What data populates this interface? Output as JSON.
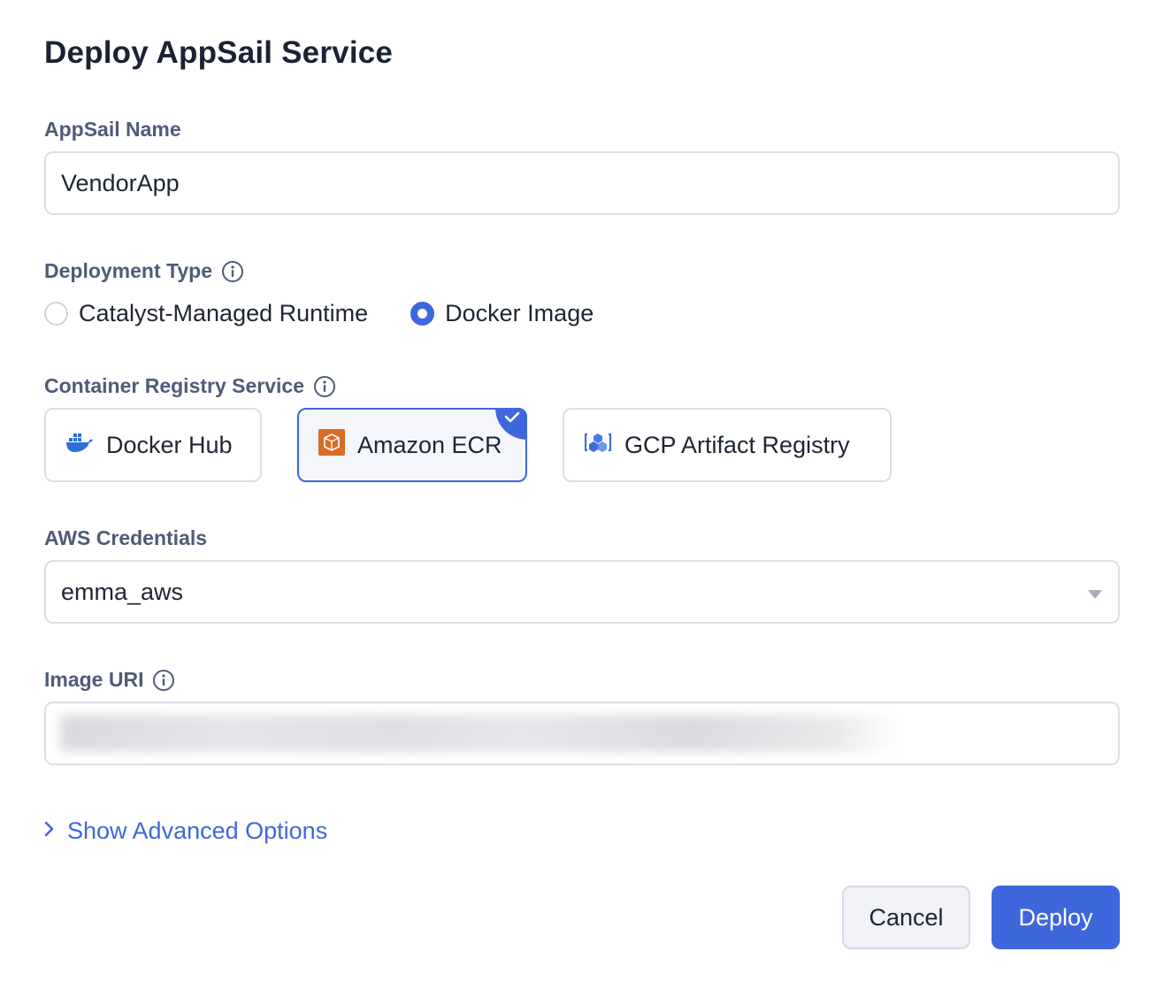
{
  "dialog": {
    "title": "Deploy AppSail Service"
  },
  "appsail_name": {
    "label": "AppSail Name",
    "value": "VendorApp"
  },
  "deployment_type": {
    "label": "Deployment Type",
    "options": [
      {
        "label": "Catalyst-Managed Runtime",
        "checked": false
      },
      {
        "label": "Docker Image",
        "checked": true
      }
    ]
  },
  "registry": {
    "label": "Container Registry Service",
    "options": [
      {
        "label": "Docker Hub",
        "icon": "docker-icon",
        "selected": false
      },
      {
        "label": "Amazon ECR",
        "icon": "amazon-ecr-icon",
        "selected": true
      },
      {
        "label": "GCP Artifact Registry",
        "icon": "gcp-artifact-registry-icon",
        "selected": false
      }
    ]
  },
  "aws_credentials": {
    "label": "AWS Credentials",
    "value": "emma_aws"
  },
  "image_uri": {
    "label": "Image URI",
    "value_redacted": true
  },
  "advanced": {
    "label": "Show Advanced Options"
  },
  "footer": {
    "cancel_label": "Cancel",
    "deploy_label": "Deploy"
  },
  "colors": {
    "accent": "#3f67dc",
    "label": "#4f5b78",
    "border": "#dcdfe8"
  }
}
